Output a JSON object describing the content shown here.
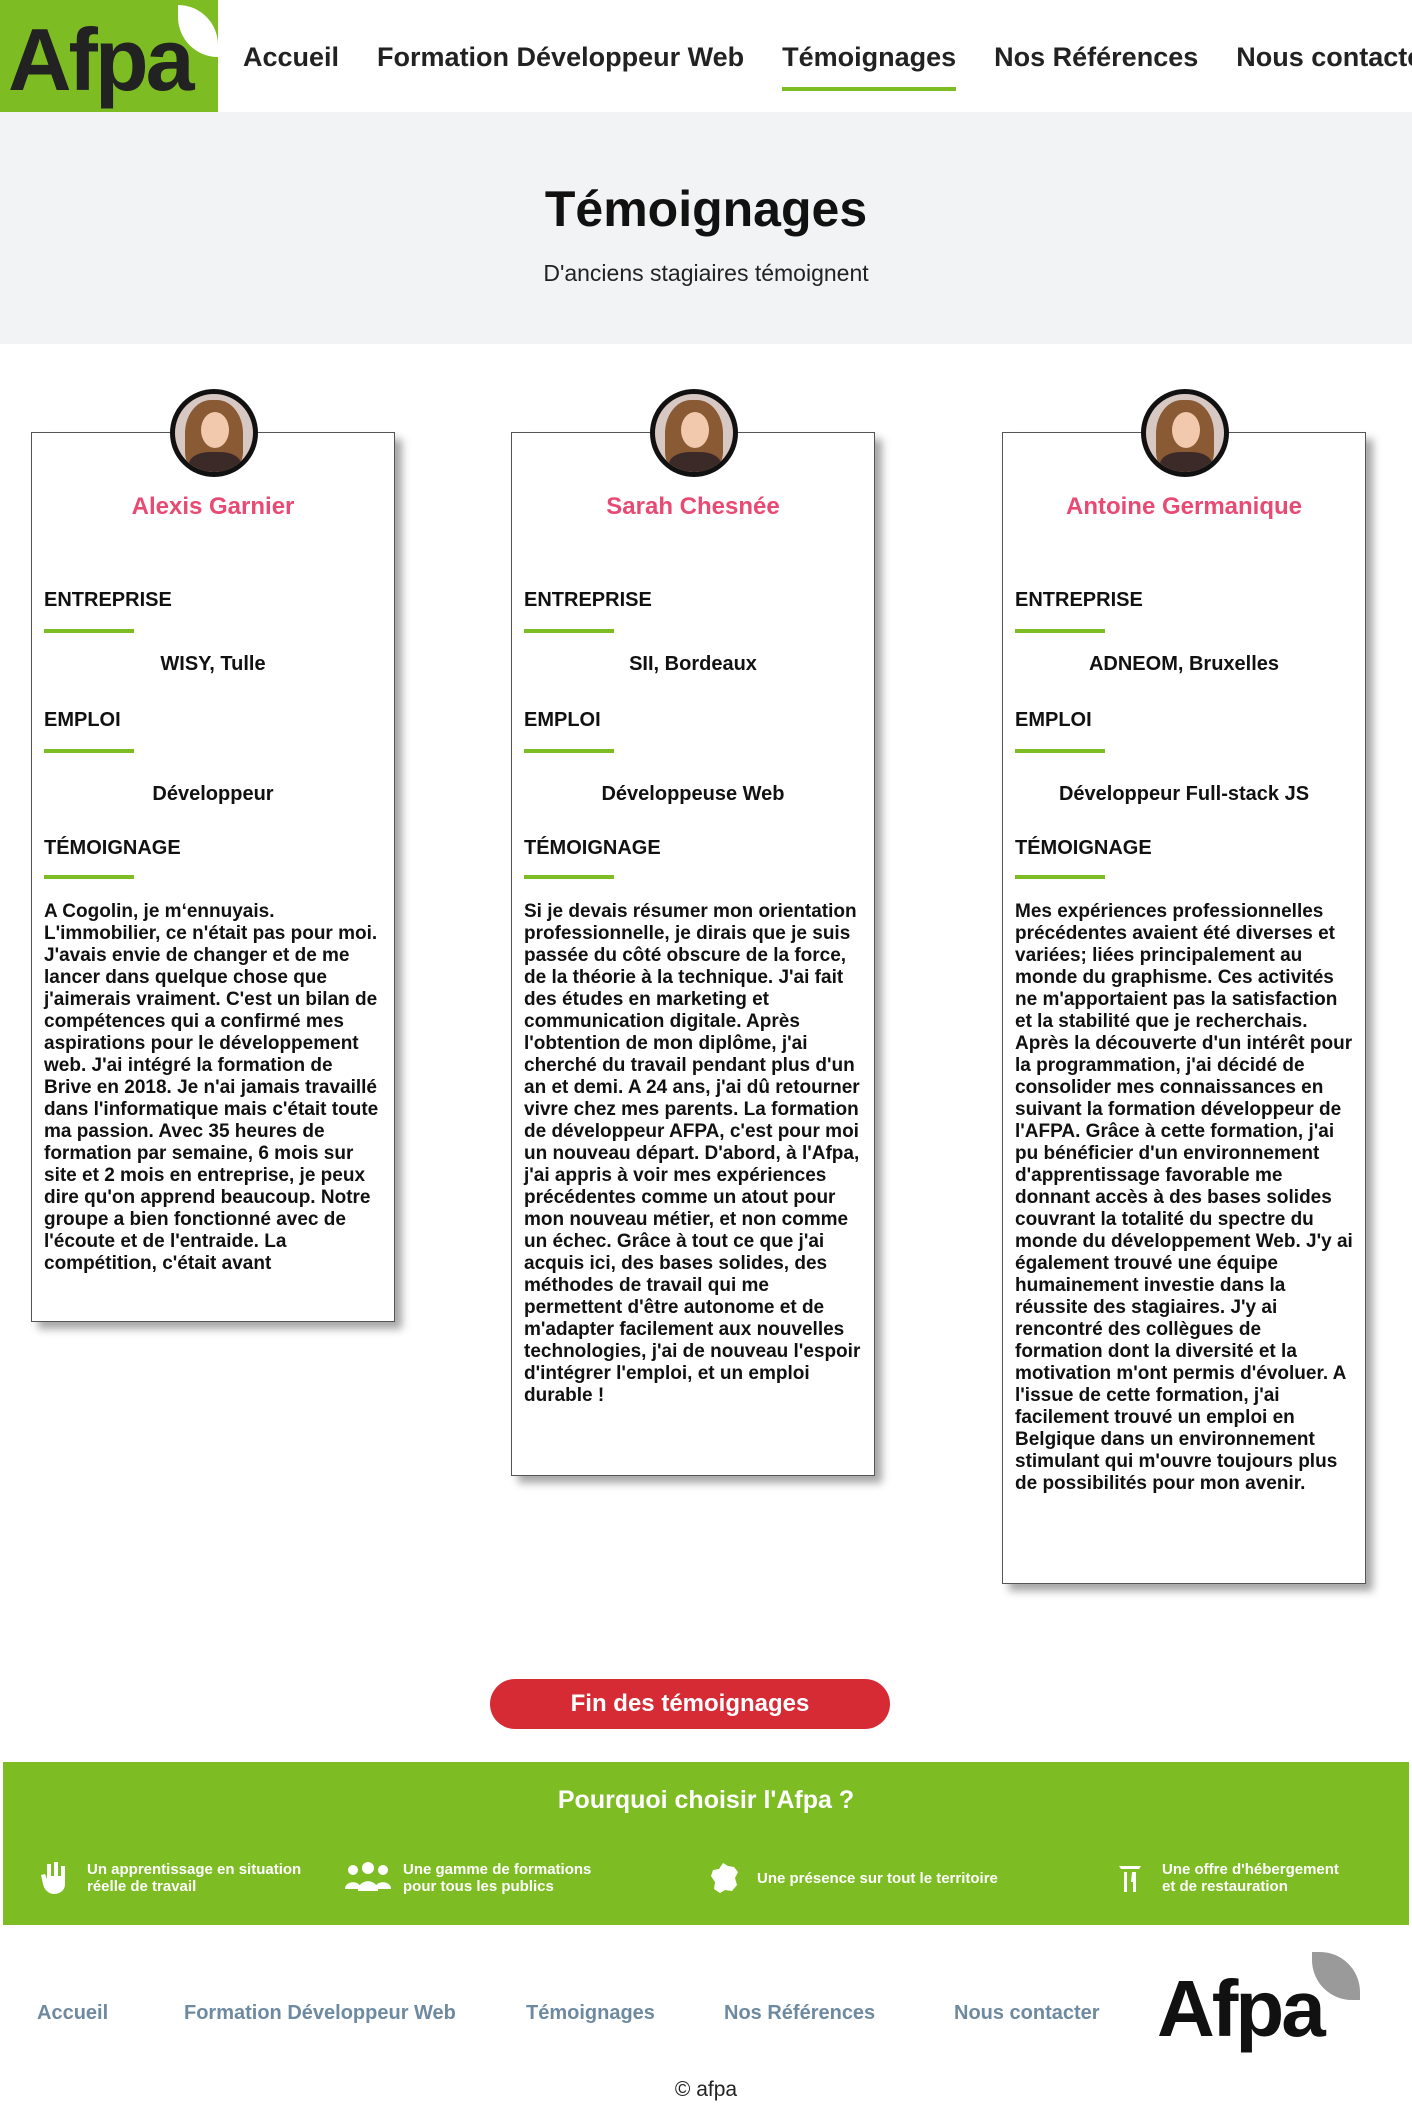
{
  "header": {
    "logo_text": "Afpa",
    "nav": [
      {
        "label": "Accueil",
        "active": false
      },
      {
        "label": "Formation Développeur Web",
        "active": false
      },
      {
        "label": "Témoignages",
        "active": true
      },
      {
        "label": "Nos Références",
        "active": false
      },
      {
        "label": "Nous contacter",
        "active": false
      }
    ]
  },
  "hero": {
    "title": "Témoignages",
    "subtitle": "D'anciens stagiaires témoignent"
  },
  "labels": {
    "company": "ENTREPRISE",
    "job": "EMPLOI",
    "testimony": "TÉMOIGNAGE"
  },
  "testimonials": [
    {
      "name": "Alexis Garnier",
      "company": "WISY, Tulle",
      "job": "Développeur",
      "text": "A Cogolin, je m‘ennuyais. L'immobilier, ce n'était pas pour moi. J'avais envie de changer et de me lancer dans quelque chose que j'aimerais vraiment. C'est un bilan de compétences qui a confirmé mes aspirations pour le développement web. J'ai intégré la formation de Brive en 2018. Je n'ai jamais travaillé dans l'informatique mais c'était toute ma passion. Avec 35 heures de formation par semaine, 6 mois sur site et 2 mois en entreprise, je peux dire qu'on apprend beaucoup. Notre groupe a bien fonctionné avec de l'écoute et de l'entraide. La compétition, c'était avant"
    },
    {
      "name": "Sarah Chesnée",
      "company": "SII, Bordeaux",
      "job": "Développeuse Web",
      "text": "Si je devais résumer mon orientation professionnelle, je dirais que je suis passée du côté obscure de la force, de la théorie à la technique. J'ai fait des études en marketing et communication digitale. Après l'obtention de mon diplôme, j'ai cherché du travail pendant plus d'un an et demi. A 24 ans, j'ai dû retourner vivre chez mes parents. La formation de développeur AFPA, c'est pour moi un nouveau départ. D'abord, à l'Afpa, j'ai appris à voir mes expériences précédentes comme un atout pour mon nouveau métier, et non comme un échec. Grâce à tout ce que j'ai acquis ici, des bases solides, des méthodes de travail qui me permettent d'être autonome et de m'adapter facilement aux nouvelles technologies, j'ai de nouveau l'espoir d'intégrer l'emploi, et un emploi durable !"
    },
    {
      "name": "Antoine Germanique",
      "company": "ADNEOM, Bruxelles",
      "job": "Développeur Full-stack JS",
      "text": "Mes expériences professionnelles précédentes avaient été diverses et variées; liées principalement au monde du graphisme. Ces activités ne m'apportaient pas la satisfaction et la stabilité que je recherchais. Après la découverte d'un intérêt pour la programmation, j'ai décidé de consolider mes connaissances en suivant la formation développeur de l'AFPA. Grâce à cette formation, j'ai pu bénéficier d'un environnement d'apprentissage favorable me donnant accès à des bases solides couvrant la totalité du spectre du monde du développement Web. J'y ai également trouvé une équipe humainement investie dans la réussite des stagiaires. J'y ai rencontré des collègues de formation dont la diversité et la motivation m'ont permis d'évoluer. A l'issue de cette formation, j'ai facilement trouvé un emploi en Belgique dans un environnement stimulant qui m'ouvre toujours plus de possibilités pour mon avenir."
    }
  ],
  "end_button": "Fin des témoignages",
  "why": {
    "title": "Pourquoi choisir l'Afpa ?",
    "features": [
      {
        "icon": "hand-icon",
        "line1": "Un apprentissage en situation",
        "line2": "réelle de travail"
      },
      {
        "icon": "group-icon",
        "line1": "Une gamme de formations",
        "line2": "pour tous les publics"
      },
      {
        "icon": "france-map-icon",
        "line1": "Une présence sur tout le territoire",
        "line2": ""
      },
      {
        "icon": "cutlery-icon",
        "line1": "Une offre d'hébergement",
        "line2": "et de restauration"
      }
    ]
  },
  "footer": {
    "nav": [
      "Accueil",
      "Formation Développeur Web",
      "Témoignages",
      "Nos Références",
      "Nous contacter"
    ],
    "logo_text": "Afpa",
    "copyright": "© afpa"
  },
  "colors": {
    "brand_green": "#7dbd23",
    "name_pink": "#e84a73",
    "button_red": "#d62b35",
    "footer_link": "#6e8aa0"
  }
}
